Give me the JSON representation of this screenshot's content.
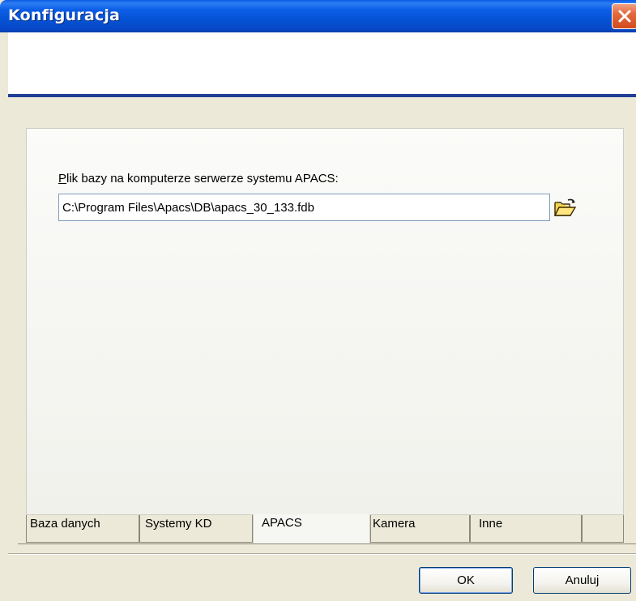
{
  "window": {
    "title": "Konfiguracja"
  },
  "apacs_page": {
    "field_label_accel": "P",
    "field_label_rest": "lik bazy na komputerze serwerze systemu APACS:",
    "db_path_value": "C:\\Program Files\\Apacs\\DB\\apacs_30_133.fdb"
  },
  "tabs": [
    {
      "label": "Baza danych",
      "active": false
    },
    {
      "label": "Systemy KD",
      "active": false
    },
    {
      "label": "APACS",
      "active": true
    },
    {
      "label": "Kamera",
      "active": false
    },
    {
      "label": "Inne",
      "active": false
    }
  ],
  "buttons": {
    "ok_label": "OK",
    "cancel_label": "Anuluj"
  },
  "colors": {
    "titlebar": "#0553d6",
    "close_button": "#d24b1d",
    "header_line": "#1f3e96"
  },
  "icons": {
    "close": "close-icon",
    "browse": "open-folder-icon"
  }
}
